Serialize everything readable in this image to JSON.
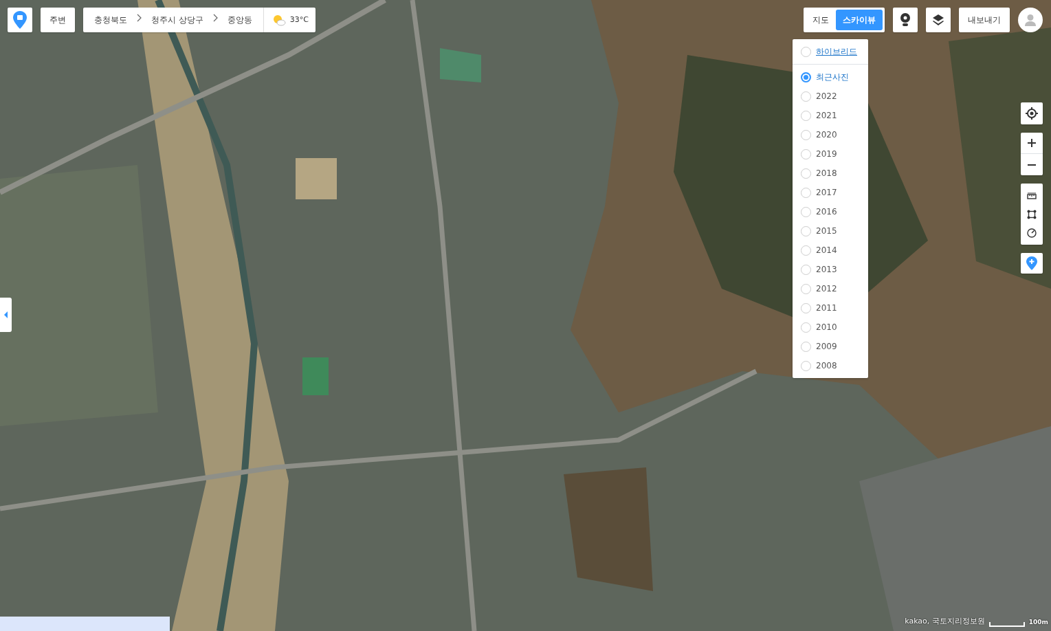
{
  "nearby_button": "주변",
  "breadcrumb": [
    "충청북도",
    "청주시 상당구",
    "중앙동"
  ],
  "weather": {
    "temperature": "33°C"
  },
  "view_toggle": [
    {
      "label": "지도",
      "selected": false
    },
    {
      "label": "스카이뷰",
      "selected": true
    }
  ],
  "export_button": "내보내기",
  "skyview_menu": {
    "hybrid": {
      "label": "하이브리드",
      "checked": false
    },
    "years": [
      {
        "label": "최근사진",
        "selected": true
      },
      {
        "label": "2022",
        "selected": false
      },
      {
        "label": "2021",
        "selected": false
      },
      {
        "label": "2020",
        "selected": false
      },
      {
        "label": "2019",
        "selected": false
      },
      {
        "label": "2018",
        "selected": false
      },
      {
        "label": "2017",
        "selected": false
      },
      {
        "label": "2016",
        "selected": false
      },
      {
        "label": "2015",
        "selected": false
      },
      {
        "label": "2014",
        "selected": false
      },
      {
        "label": "2013",
        "selected": false
      },
      {
        "label": "2012",
        "selected": false
      },
      {
        "label": "2011",
        "selected": false
      },
      {
        "label": "2010",
        "selected": false
      },
      {
        "label": "2009",
        "selected": false
      },
      {
        "label": "2008",
        "selected": false
      }
    ]
  },
  "attribution": "kakao, 국토지리정보원",
  "scale": "100m"
}
